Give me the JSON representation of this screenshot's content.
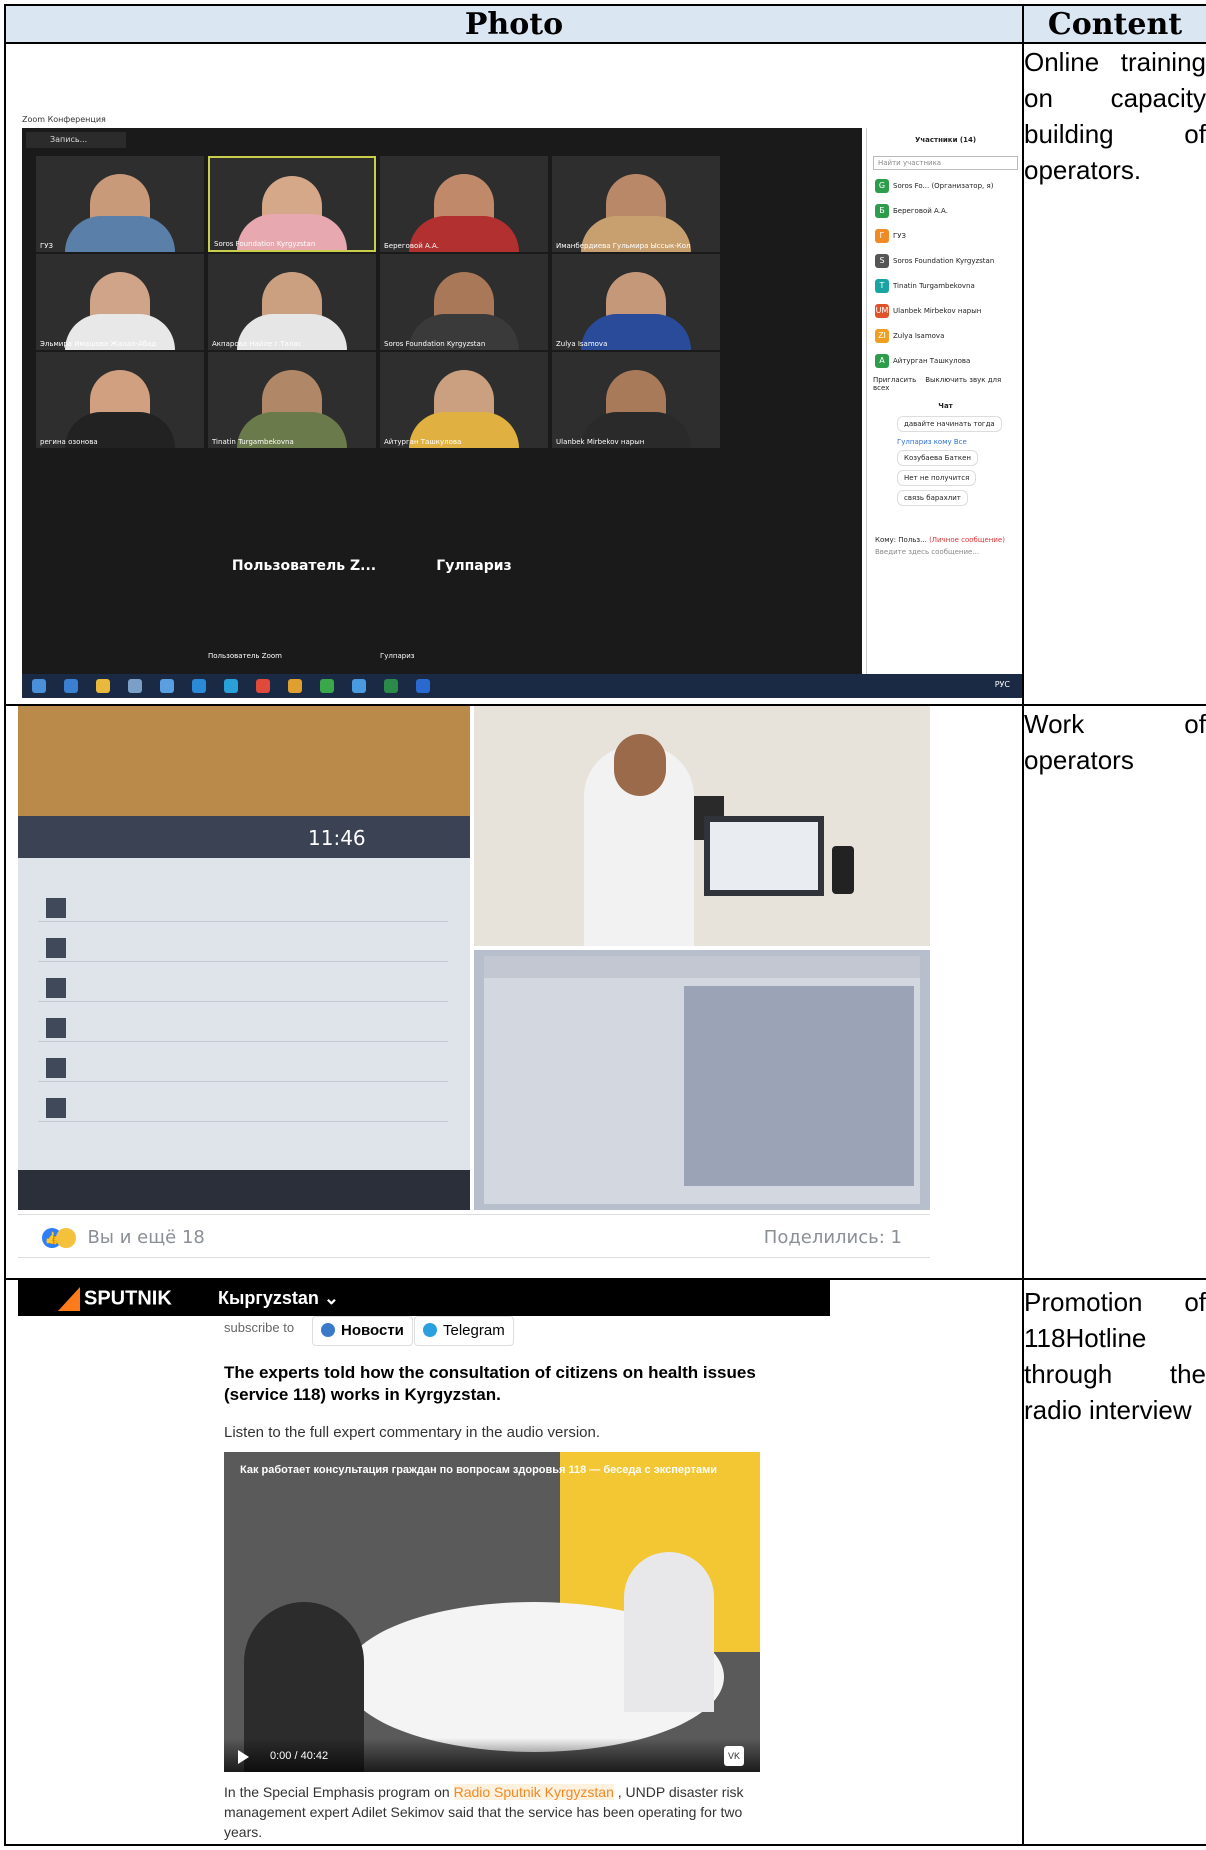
{
  "table": {
    "header_photo": "Photo",
    "header_content": "Content"
  },
  "rows": [
    {
      "content": "Online training on capacity building of operators."
    },
    {
      "content": "Work of operators"
    },
    {
      "content": "Promotion of 118Hotline through the radio interview"
    }
  ],
  "zoom": {
    "window_title": "Zoom Конференция",
    "record_label": "Запись...",
    "participants_title": "Участники (14)",
    "search_placeholder": "Найти участника",
    "participants": [
      {
        "initial": "G",
        "color": "#2e9d4b",
        "name": "Soros Fo... (Организатор, я)"
      },
      {
        "initial": "Б",
        "color": "#2e9d4b",
        "name": "Береговой А.А."
      },
      {
        "initial": "Г",
        "color": "#f08a24",
        "name": "ГУЗ"
      },
      {
        "initial": "S",
        "color": "#555555",
        "name": "Soros Foundation Kyrgyzstan"
      },
      {
        "initial": "T",
        "color": "#1aa3a3",
        "name": "Tinatin Turgambekovna"
      },
      {
        "initial": "UM",
        "color": "#e0522a",
        "name": "Ulanbek Mirbekov нарын"
      },
      {
        "initial": "ZI",
        "color": "#f0a020",
        "name": "Zulya Isamova"
      },
      {
        "initial": "A",
        "color": "#2e9d4b",
        "name": "Айтурган Ташкулова"
      }
    ],
    "invite_label": "Пригласить",
    "mute_all_label": "Выключить звук для всех",
    "chat_title": "Чат",
    "chat": [
      "давайте начинать тогда",
      "Козубаева Баткен",
      "Нет не получится",
      "связь барахлит"
    ],
    "chat_meta": "Гулпариз кому Все",
    "to_label": "Кому:",
    "to_value": "Польз...",
    "private_label": "(Личное сообщение)",
    "message_placeholder": "Введите здесь сообщение...",
    "tiles": [
      "ГУЗ",
      "Soros Foundation Kyrgyzstan",
      "Береговой А.А.",
      "Иманбердиева Гульмира Ыссык-Кол",
      "Эльмира Имашова Жалал-Абад",
      "Акпарова Найле г.Талас",
      "Soros Foundation Kyrgyzstan",
      "Zulya Isamova",
      "регина озонова",
      "Tinatin Turgambekovna",
      "Айтурган Ташкулова",
      "Ulanbek Mirbekov нарын"
    ],
    "name_tiles": [
      {
        "big": "Пользователь  Z...",
        "small": "Пользователь Zoom"
      },
      {
        "big": "Гулпариз",
        "small": "Гулпариз"
      }
    ],
    "lang": "РУС"
  },
  "operators": {
    "clock": "11:46",
    "likes_text": "Вы и ещё 18",
    "shares_text": "Поделились: 1"
  },
  "sputnik": {
    "logo": "SPUTNIK",
    "region": "Кыргyzstan ⌄",
    "subscribe": "subscribe to",
    "chip_news": "Новости",
    "chip_telegram": "Telegram",
    "headline": "The experts told how the consultation of citizens on health issues (service 118) works in Kyrgyzstan.",
    "lead": "Listen to the full expert commentary in the audio version.",
    "video_title": "Как работает консультация граждан по вопросам здоровья 118 — беседа с экспертами",
    "video_time": "0:00 / 40:42",
    "caption_pre": "In the Special Emphasis program on",
    "caption_link": "Radio Sputnik Kyrgyzstan",
    "caption_post": ", UNDP disaster risk management expert Adilet Sekimov said that the service has been operating for two years."
  }
}
